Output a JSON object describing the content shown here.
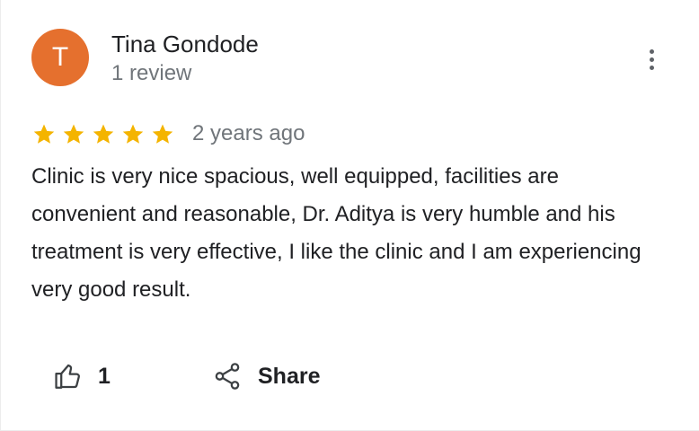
{
  "reviewer": {
    "initial": "T",
    "avatar_color": "#e5702e",
    "name": "Tina Gondode",
    "meta": "1 review"
  },
  "more_menu": {
    "icon": "more-vert-icon"
  },
  "rating": {
    "stars": 5,
    "max_stars": 5,
    "star_color": "#f4b400",
    "date": "2 years ago"
  },
  "review": {
    "text": "Clinic is very nice spacious, well equipped,  facilities are convenient and reasonable,  Dr.  Aditya is very humble and his treatment is very effective, I like the clinic and I am experiencing very good result."
  },
  "actions": {
    "like": {
      "icon": "thumb-up-icon",
      "count": "1"
    },
    "share": {
      "icon": "share-icon",
      "label": "Share"
    }
  }
}
